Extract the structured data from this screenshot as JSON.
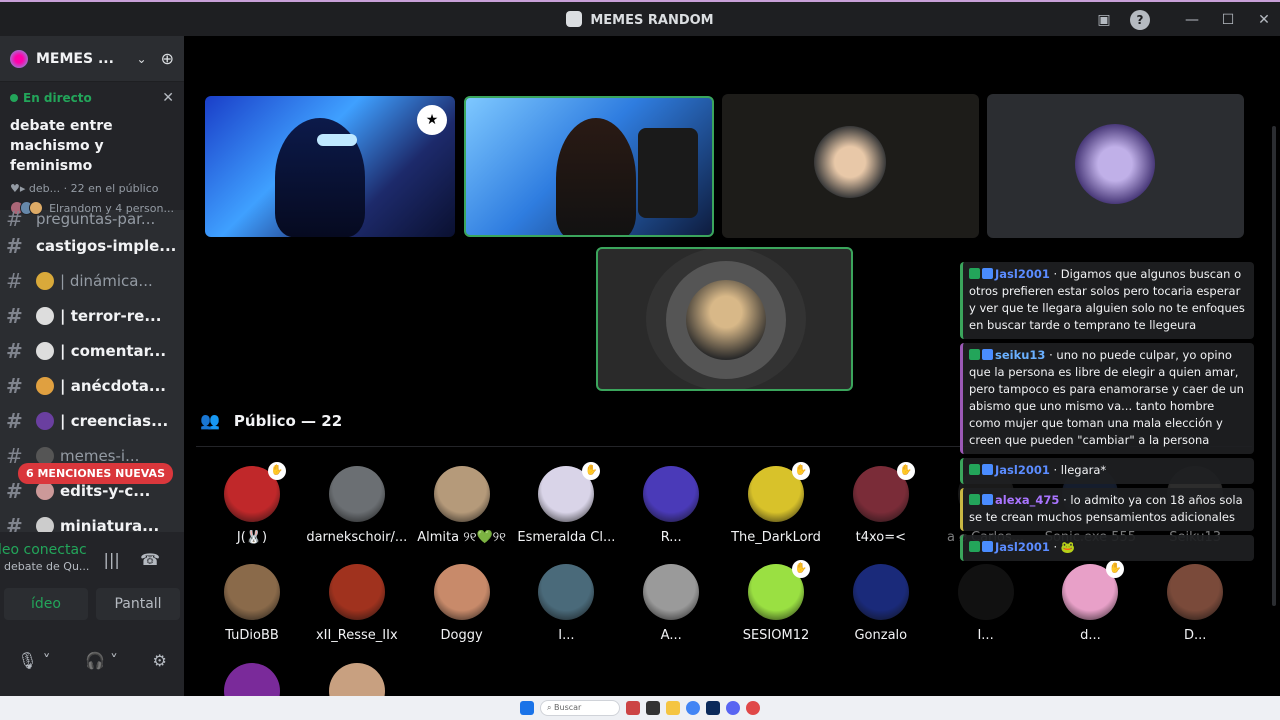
{
  "window": {
    "title": "MEMES RANDOM"
  },
  "sidebar": {
    "server_name": "MEMES ...",
    "live": {
      "status": "En directo",
      "title": "debate entre machismo y feminismo",
      "meta": "deb... · 22 en el público",
      "people": "Elrandom y 4 person..."
    },
    "channels": [
      {
        "name": "preguntas-par...",
        "emoji": "",
        "bold": false
      },
      {
        "name": "castigos-imple...",
        "emoji": "",
        "bold": true
      },
      {
        "name": "| dinámica...",
        "emoji": "#d9a93a",
        "bold": false
      },
      {
        "name": "| terror-re...",
        "emoji": "#ddd",
        "bold": true
      },
      {
        "name": "| comentar...",
        "emoji": "#ddd",
        "bold": true
      },
      {
        "name": "| anécdota...",
        "emoji": "#e0a040",
        "bold": true
      },
      {
        "name": "| creencias...",
        "emoji": "#6a3fa0",
        "bold": true
      },
      {
        "name": "memes-i...",
        "emoji": "#555",
        "bold": false
      },
      {
        "name": "edits-y-c...",
        "emoji": "#c99",
        "bold": true
      },
      {
        "name": "miniatura...",
        "emoji": "#ccc",
        "bold": true
      }
    ],
    "mentions_badge": "6 MENCIONES NUEVAS",
    "voice": {
      "status": "leo conectac",
      "channel": "debate de Qu...",
      "video_label": "ídeo",
      "screen_label": "Pantall"
    }
  },
  "main": {
    "public_label": "Público — 22",
    "audience": [
      {
        "name": "J(🐰)",
        "color": "#c0282a",
        "hand": true
      },
      {
        "name": "darnekschoir/...",
        "color": "#6b6f73",
        "hand": false
      },
      {
        "name": "Almita ୨୧💚୨୧",
        "color": "#b59a7a",
        "hand": false
      },
      {
        "name": "Esmeralda Cl...",
        "color": "#d9d4e8",
        "hand": true
      },
      {
        "name": "R...",
        "color": "#4a3ab8",
        "hand": false
      },
      {
        "name": "The_DarkLord",
        "color": "#d8c22a",
        "hand": true
      },
      {
        "name": "t4xo=<",
        "color": "#7a2c38",
        "hand": true
      },
      {
        "name": "TuDioBB",
        "color": "#8a6a4a",
        "hand": false
      },
      {
        "name": "xII_Resse_IIx",
        "color": "#a0321e",
        "hand": false
      },
      {
        "name": "Doggy",
        "color": "#c88a6a",
        "hand": false
      },
      {
        "name": "I...",
        "color": "#4a6a7a",
        "hand": false
      },
      {
        "name": "A...",
        "color": "#9a9a9a",
        "hand": false
      },
      {
        "name": "SESIOM12",
        "color": "#9ae042",
        "hand": true
      },
      {
        "name": "Gonzalo",
        "color": "#1a2a7a",
        "hand": false
      },
      {
        "name": "I...",
        "color": "#111",
        "hand": false
      },
      {
        "name": "d...",
        "color": "#e8a0c8",
        "hand": true
      },
      {
        "name": "D...",
        "color": "#7a4a3a",
        "hand": false
      },
      {
        "name": "a ⌀  Carlos...",
        "color": "#333",
        "hand": false
      },
      {
        "name": "Sonic.exe 555",
        "color": "#2a3a5a",
        "hand": false
      },
      {
        "name": "Seiku13",
        "color": "#5a5a5a",
        "hand": false
      }
    ],
    "chat": [
      {
        "user": "Jasl2001",
        "text": " · Digamos que algunos buscan o otros prefieren estar solos pero tocaria esperar y ver que te llegara alguien solo no te enfoques en buscar tarde o temprano te llegeura"
      },
      {
        "user": "seiku13",
        "text": " · uno no puede culpar, yo opino que la persona es libre de elegir a quien amar, pero tampoco es para enamorarse y caer de un abismo que uno mismo va... tanto hombre como mujer que toman una mala elección y creen que pueden \"cambiar\" a la persona"
      },
      {
        "user": "Jasl2001",
        "text": " · llegara*"
      },
      {
        "user": "alexa_475",
        "text": " · lo admito ya con 18 años sola se te crean muchos pensamientos adicionales"
      },
      {
        "user": "Jasl2001",
        "text": " · 🐸"
      }
    ]
  },
  "taskbar": {
    "search_placeholder": "Buscar"
  }
}
